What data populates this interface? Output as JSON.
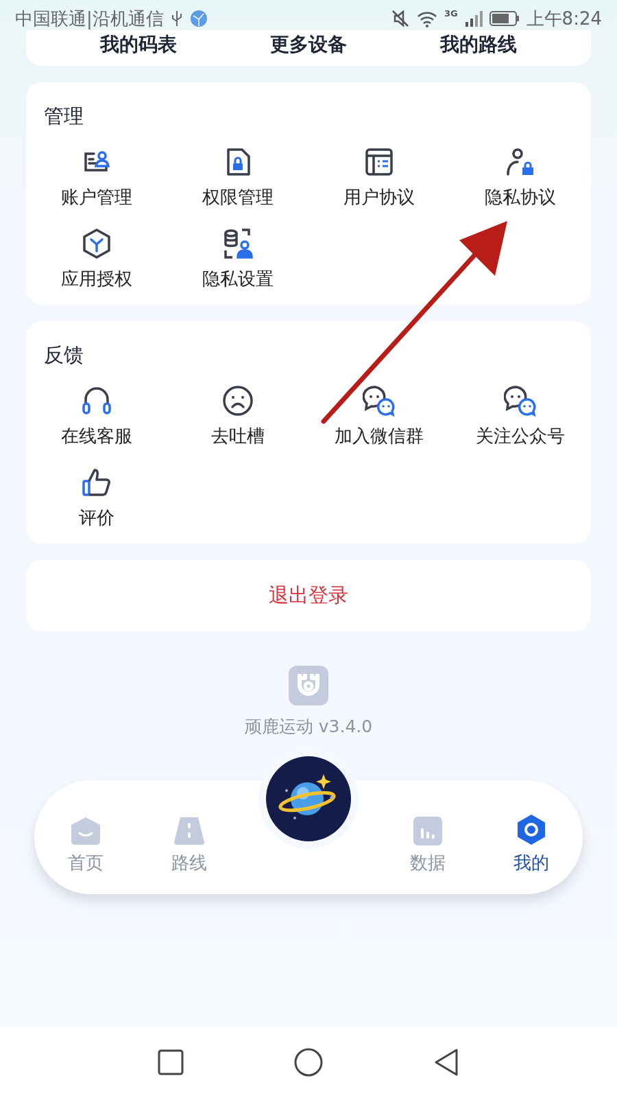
{
  "status_bar": {
    "carrier": "中国联通|沿机通信",
    "network": "3G",
    "time": "上午8:24"
  },
  "top_links": [
    "我的码表",
    "更多设备",
    "我的路线"
  ],
  "sections": [
    {
      "title": "管理",
      "items": [
        "账户管理",
        "权限管理",
        "用户协议",
        "隐私协议",
        "应用授权",
        "隐私设置"
      ]
    },
    {
      "title": "反馈",
      "items": [
        "在线客服",
        "去吐槽",
        "加入微信群",
        "关注公众号",
        "评价"
      ]
    }
  ],
  "logout": "退出登录",
  "app_version": "顽鹿运动 v3.4.0",
  "tabs": [
    {
      "label": "首页",
      "selected": false
    },
    {
      "label": "路线",
      "selected": false
    },
    {
      "label": "数据",
      "selected": false
    },
    {
      "label": "我的",
      "selected": true
    }
  ]
}
